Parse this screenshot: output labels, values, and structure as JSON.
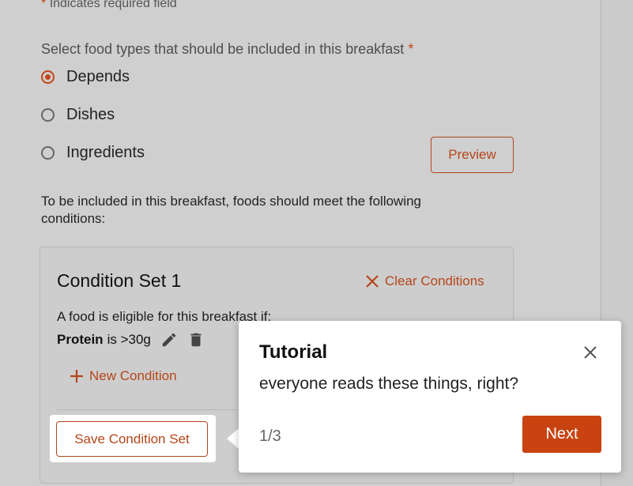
{
  "form": {
    "required_star": "*",
    "required_note": "Indicates required field",
    "food_types_label": "Select food types that should be included in this breakfast",
    "food_types_required_star": "*",
    "options": [
      {
        "label": "Depends",
        "checked": true
      },
      {
        "label": "Dishes",
        "checked": false
      },
      {
        "label": "Ingredients",
        "checked": false
      }
    ],
    "preview_label": "Preview",
    "conditions_intro": "To be included in this breakfast, foods should meet the following conditions:"
  },
  "condition_set": {
    "title": "Condition Set 1",
    "clear_label": "Clear Conditions",
    "eligible_text": "A food is eligible for this breakfast if:",
    "condition": {
      "field": "Protein",
      "rule": "is >30g"
    },
    "new_condition_label": "New Condition",
    "save_label": "Save Condition Set"
  },
  "tutorial": {
    "title": "Tutorial",
    "body": "everyone reads these things, right?",
    "step": "1/3",
    "next_label": "Next"
  },
  "colors": {
    "accent": "#b4461b",
    "primary_button": "#c8430f",
    "overlay": "#cfcfcf"
  }
}
